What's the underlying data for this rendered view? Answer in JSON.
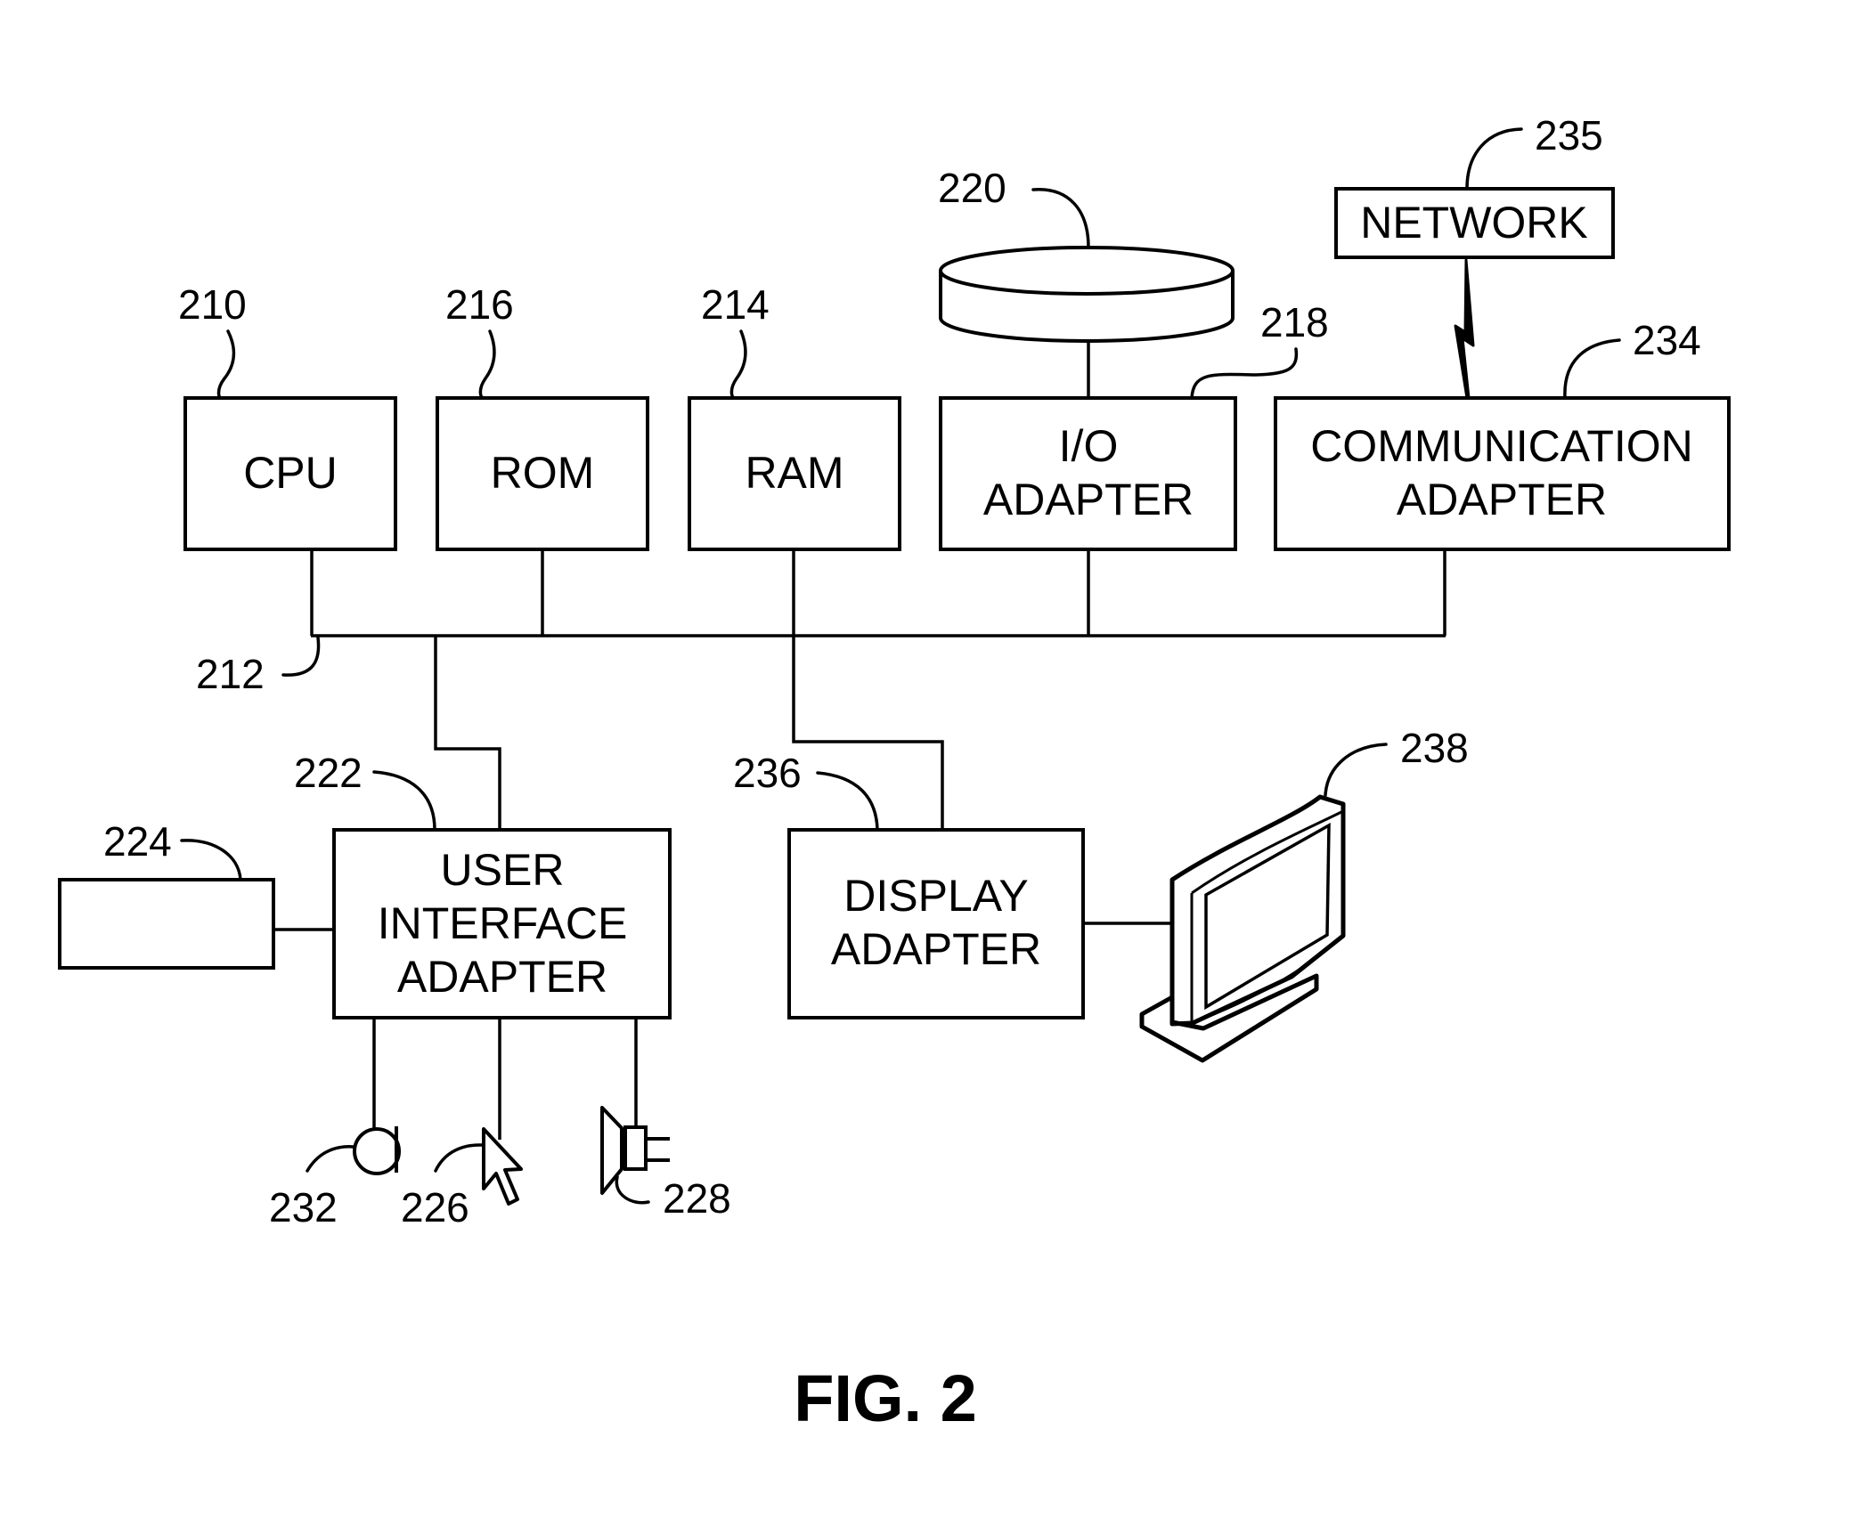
{
  "figure": {
    "caption": "FIG. 2",
    "type": "block diagram"
  },
  "blocks": {
    "cpu": {
      "label": "CPU",
      "ref": "210"
    },
    "rom": {
      "label": "ROM",
      "ref": "216"
    },
    "ram": {
      "label": "RAM",
      "ref": "214"
    },
    "io_adapter": {
      "label_line1": "I/O",
      "label_line2": "ADAPTER",
      "ref": "218"
    },
    "comm_adapter": {
      "label_line1": "COMMUNICATION",
      "label_line2": "ADAPTER",
      "ref": "234"
    },
    "network": {
      "label": "NETWORK",
      "ref": "235"
    },
    "disk": {
      "ref": "220"
    },
    "bus": {
      "ref": "212"
    },
    "ui_adapter": {
      "label_line1": "USER",
      "label_line2": "INTERFACE",
      "label_line3": "ADAPTER",
      "ref": "222"
    },
    "keyboard": {
      "ref": "224"
    },
    "display_adapter": {
      "label_line1": "DISPLAY",
      "label_line2": "ADAPTER",
      "ref": "236"
    },
    "display": {
      "ref": "238"
    },
    "microphone": {
      "ref": "232"
    },
    "mouse": {
      "ref": "226"
    },
    "speaker": {
      "ref": "228"
    }
  }
}
